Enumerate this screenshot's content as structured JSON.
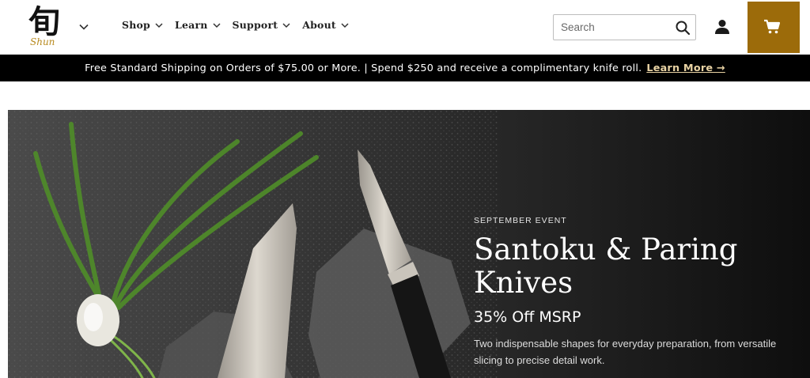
{
  "header": {
    "logo": {
      "kanji": "旬",
      "wordmark": "Shun"
    },
    "nav": [
      {
        "label": "Shop"
      },
      {
        "label": "Learn"
      },
      {
        "label": "Support"
      },
      {
        "label": "About"
      }
    ],
    "search": {
      "placeholder": "Search",
      "value": ""
    },
    "icons": {
      "search": "search-icon",
      "account": "account-icon",
      "cart": "cart-icon"
    },
    "colors": {
      "cart_bg": "#9c6b0a"
    }
  },
  "promo": {
    "text": "Free Standard Shipping on Orders of $75.00 or More. |  Spend $250 and receive a complimentary knife roll.",
    "link": "Learn More →"
  },
  "hero": {
    "eyebrow": "SEPTEMBER EVENT",
    "title": "Santoku & Paring Knives",
    "subtitle": "35% Off MSRP",
    "description": "Two indispensable shapes for everyday preparation, from versatile slicing to precise detail work."
  }
}
